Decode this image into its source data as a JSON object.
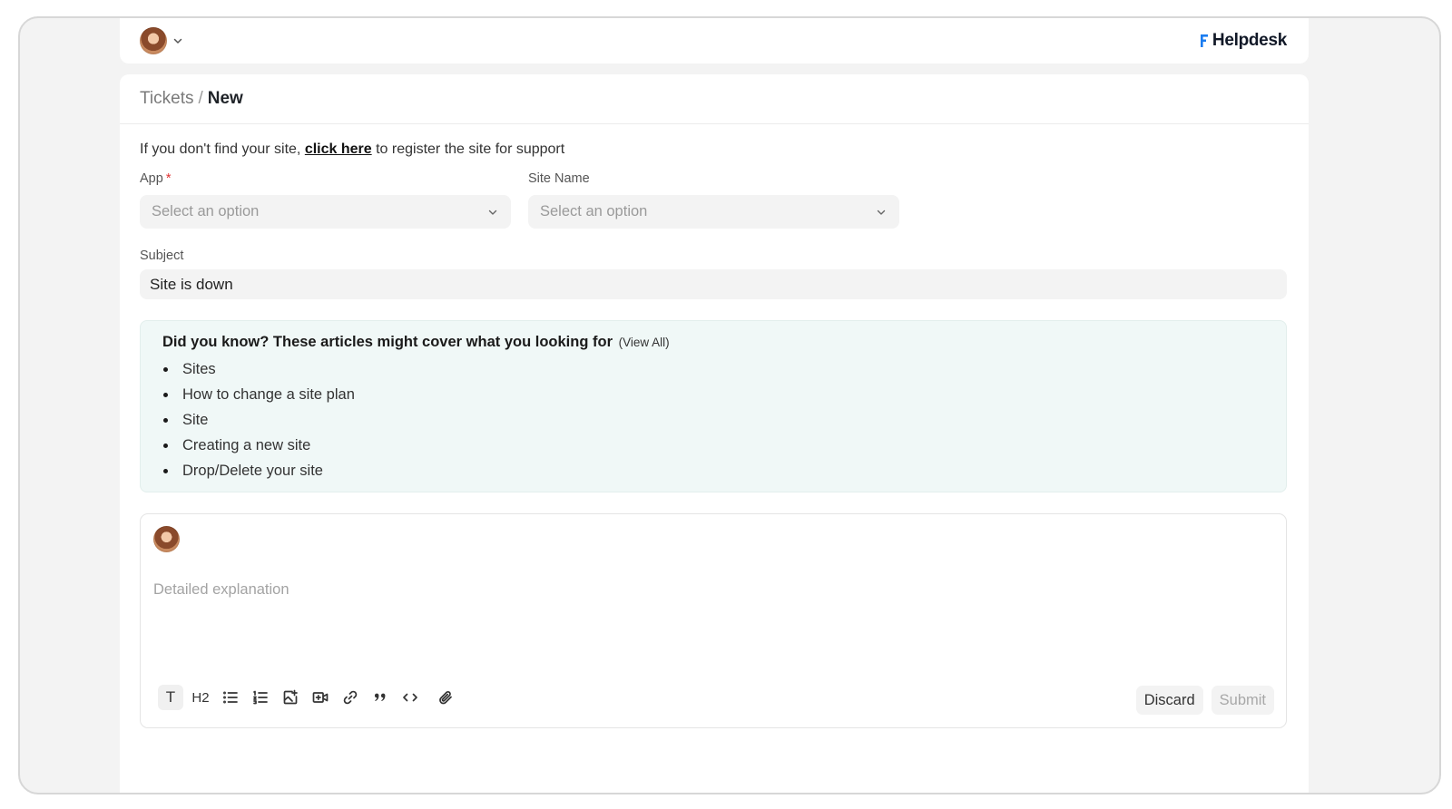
{
  "header": {
    "brand_name": "Helpdesk",
    "brand_color": "#1a7cf0"
  },
  "breadcrumb": {
    "parent": "Tickets",
    "separator": "/",
    "current": "New"
  },
  "notice": {
    "prefix": "If you don't find your site, ",
    "link_text": "click here",
    "suffix": " to register the site for support"
  },
  "form": {
    "app": {
      "label": "App",
      "required_mark": "*",
      "placeholder": "Select an option"
    },
    "site_name": {
      "label": "Site Name",
      "placeholder": "Select an option"
    },
    "subject": {
      "label": "Subject",
      "value": "Site is down"
    }
  },
  "articles": {
    "title": "Did you know? These articles might cover what you looking for",
    "view_all": "(View All)",
    "items": [
      "Sites",
      "How to change a site plan",
      "Site",
      "Creating a new site",
      "Drop/Delete your site"
    ]
  },
  "editor": {
    "placeholder": "Detailed explanation",
    "toolbar": {
      "text": "T",
      "heading": "H2"
    },
    "discard_label": "Discard",
    "submit_label": "Submit"
  },
  "colors": {
    "accent": "#1a7cf0",
    "required": "#e03131",
    "articles_bg": "#f0f8f7"
  }
}
